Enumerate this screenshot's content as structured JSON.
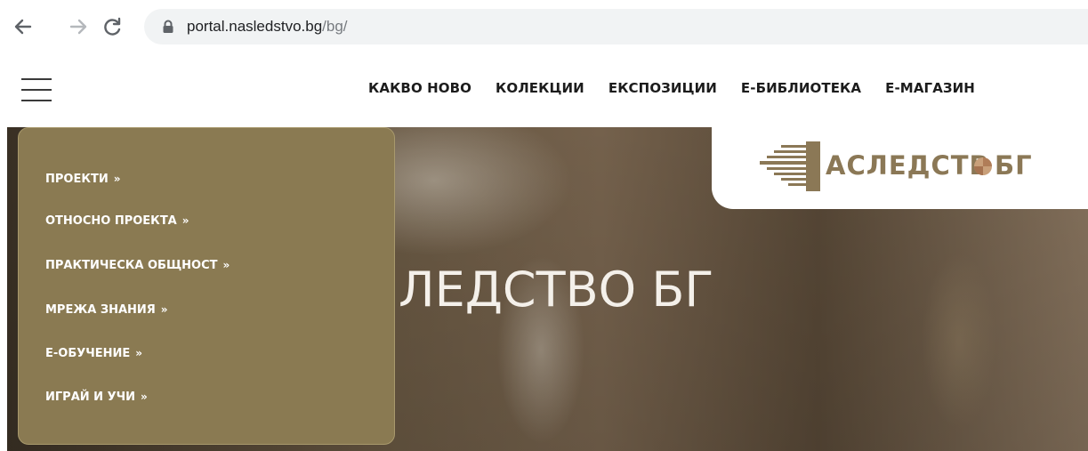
{
  "browser": {
    "url_host": "portal.nasledstvo.bg",
    "url_path": "/bg/"
  },
  "header": {
    "nav_items": [
      {
        "label": "КАКВО НОВО"
      },
      {
        "label": "КОЛЕКЦИИ"
      },
      {
        "label": "ЕКСПОЗИЦИИ"
      },
      {
        "label": "Е-БИБЛИОТЕКА"
      },
      {
        "label": "Е-МАГАЗИН"
      }
    ]
  },
  "logo": {
    "text_main": "АСЛЕДСТВ",
    "text_tail": "БГ"
  },
  "hero": {
    "title": "ЛЕДСТВО БГ"
  },
  "dropdown": {
    "items": [
      {
        "label": "ПРОЕКТИ"
      },
      {
        "label": "ОТНОСНО ПРОЕКТА"
      },
      {
        "label": "ПРАКТИЧЕСКА ОБЩНОСТ"
      },
      {
        "label": "МРЕЖА ЗНАНИЯ"
      },
      {
        "label": "Е-ОБУЧЕНИЕ"
      },
      {
        "label": "ИГРАЙ И УЧИ"
      }
    ],
    "chevron": "»"
  },
  "colors": {
    "menu_bg": "#8a7a52",
    "brand_gold": "#8b7856"
  },
  "icons": {
    "back": "back-arrow-icon",
    "forward": "forward-arrow-icon",
    "reload": "reload-icon",
    "lock": "lock-icon",
    "menu": "hamburger-menu-icon",
    "logo": "nasledstvo-logo-icon"
  }
}
